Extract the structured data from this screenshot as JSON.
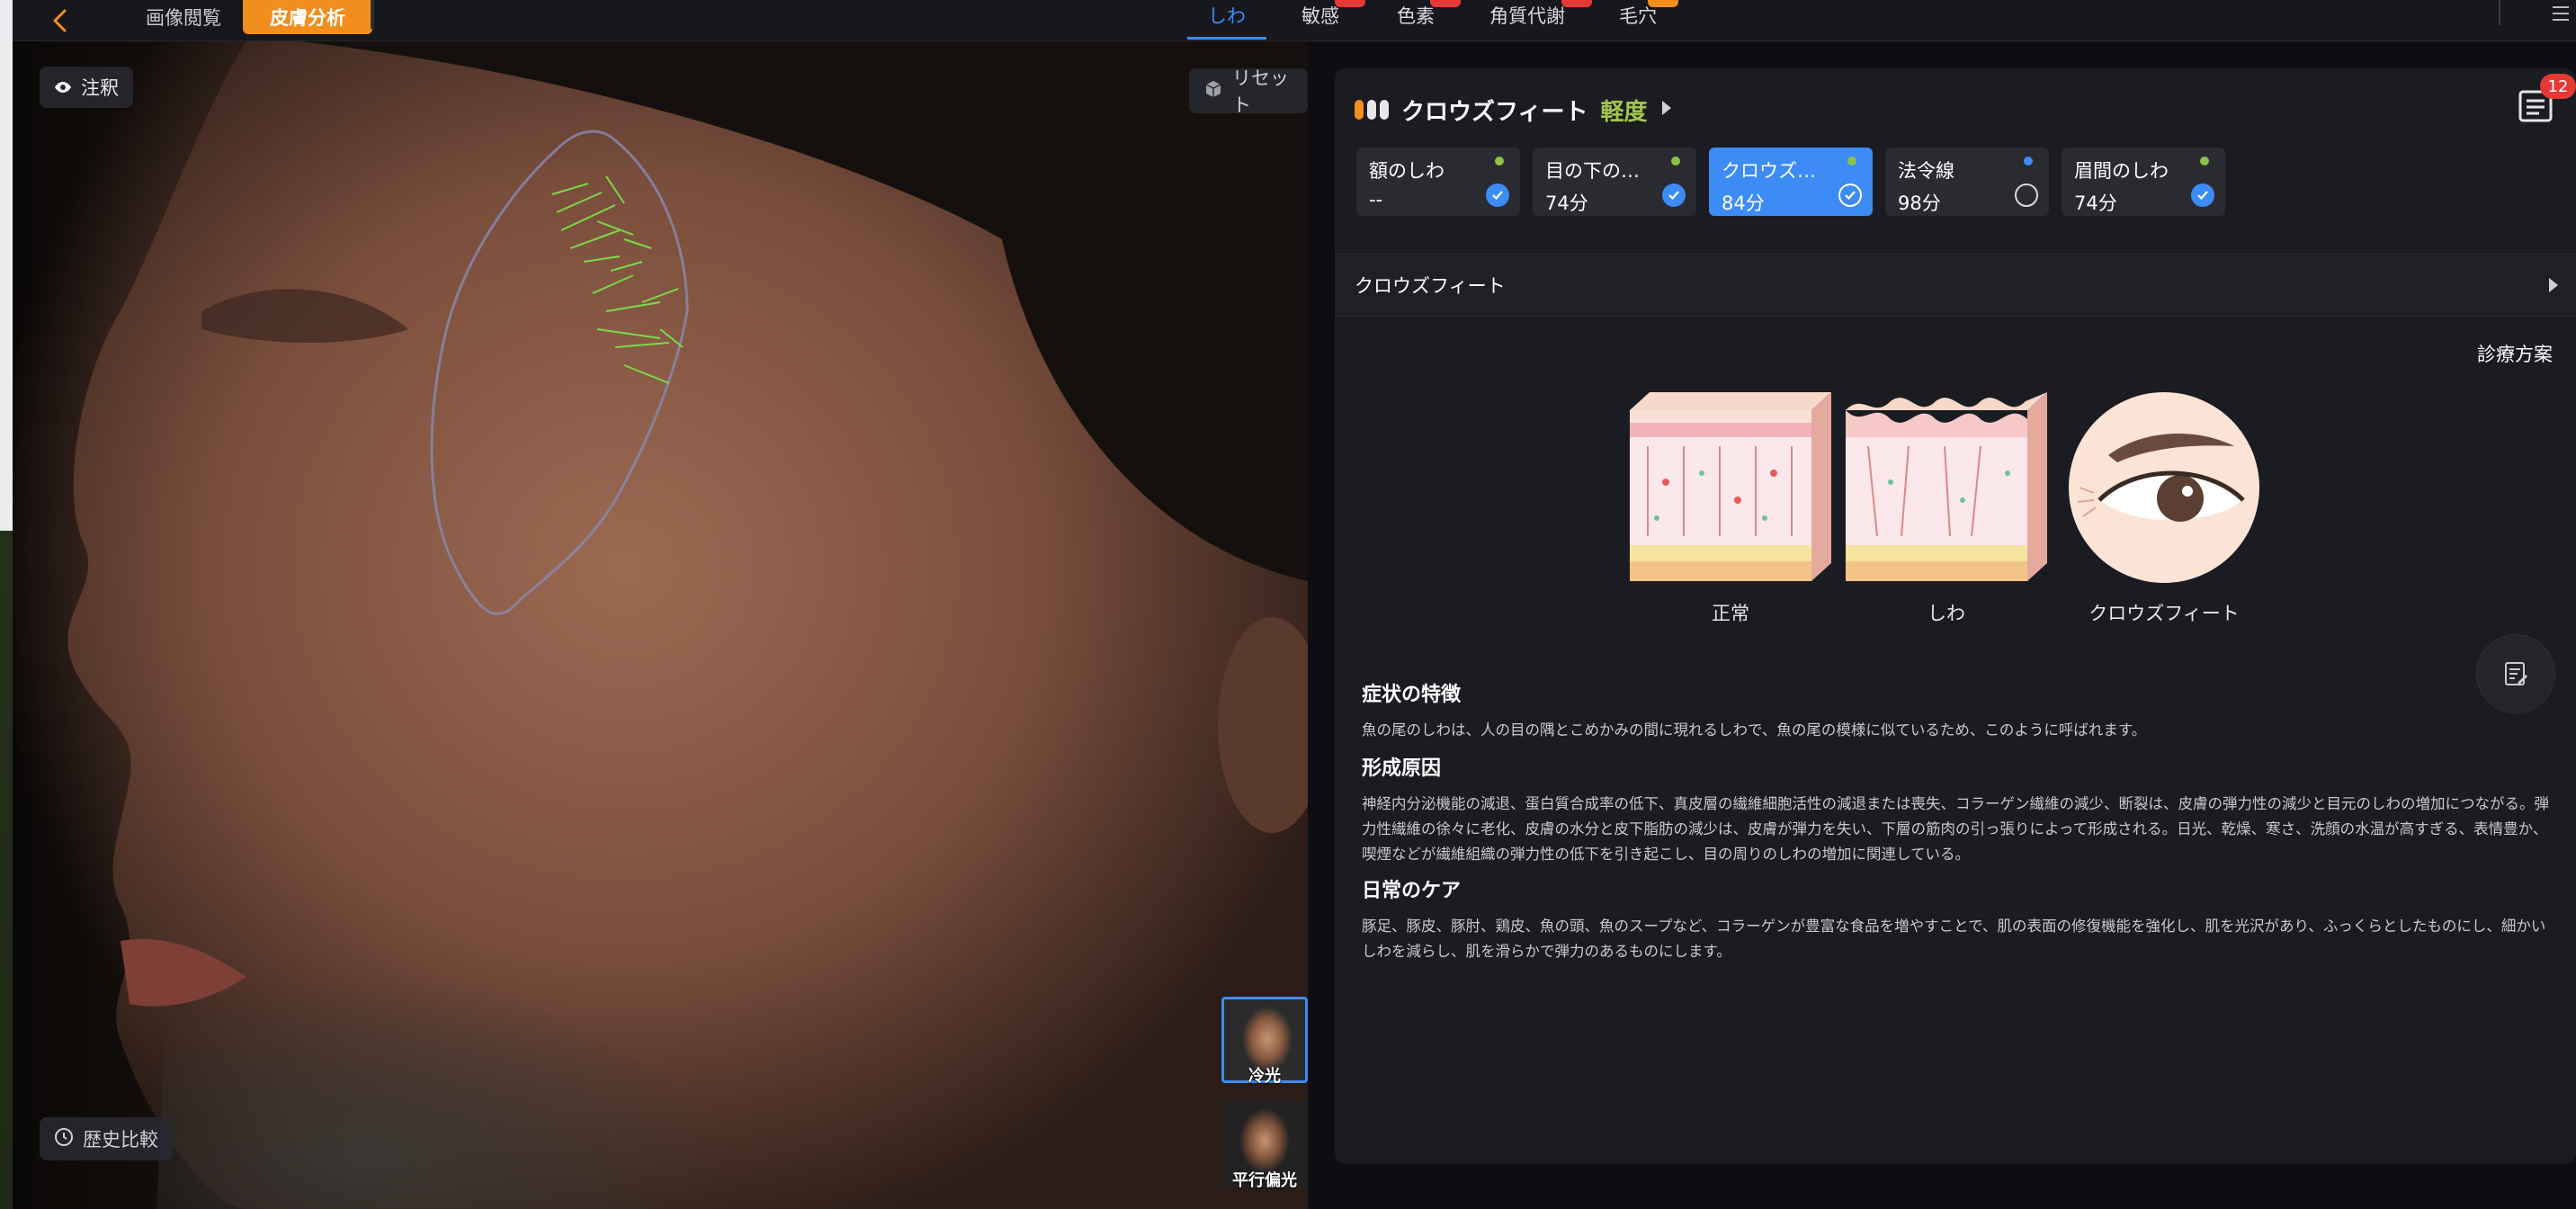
{
  "topbar": {
    "back_icon": "chevron-left-icon",
    "tab_image_view": "画像閲覧",
    "tab_skin_analysis": "皮膚分析",
    "categories": [
      {
        "label": "しわ",
        "active": true
      },
      {
        "label": "敏感",
        "badge_color": "#e53935"
      },
      {
        "label": "色素",
        "badge_color": "#e53935"
      },
      {
        "label": "角質代謝",
        "badge_color": "#e53935"
      },
      {
        "label": "毛穴",
        "badge_color": "#f28e1d"
      }
    ],
    "menu_icon": "menu-icon"
  },
  "viewer": {
    "note_label": "注釈",
    "reset_label": "リセット",
    "history_label": "歴史比較",
    "thumbnails": [
      {
        "label": "冷光",
        "selected": true
      },
      {
        "label": "平行偏光",
        "selected": false
      }
    ]
  },
  "panel": {
    "title": "クロウズフィート",
    "level": "軽度",
    "report_badge": "12",
    "cards": [
      {
        "name": "額のしわ",
        "score": "--",
        "dot_color": "#8bc34a",
        "checked": true,
        "active": false
      },
      {
        "name": "目の下の細…",
        "score": "74分",
        "dot_color": "#8bc34a",
        "checked": true,
        "active": false
      },
      {
        "name": "クロウズフ…",
        "score": "84分",
        "dot_color": "#8bc34a",
        "checked": true,
        "active": true
      },
      {
        "name": "法令線",
        "score": "98分",
        "dot_color": "#3d8bf5",
        "checked": false,
        "active": false
      },
      {
        "name": "眉間のしわ",
        "score": "74分",
        "dot_color": "#8bc34a",
        "checked": true,
        "active": false
      }
    ],
    "section_label": "クロウズフィート",
    "treatment_label": "診療方案",
    "illustrations": [
      "正常",
      "しわ",
      "クロウズフィート"
    ],
    "symptom_title": "症状の特徴",
    "symptom_text": "魚の尾のしわは、人の目の隅とこめかみの間に現れるしわで、魚の尾の模様に似ているため、このように呼ばれます。",
    "cause_title": "形成原因",
    "cause_text": "神経内分泌機能の減退、蛋白質合成率の低下、真皮層の繊維細胞活性の減退または喪失、コラーゲン繊維の減少、断裂は、皮膚の弾力性の減少と目元のしわの増加につながる。弾力性繊維の徐々に老化、皮膚の水分と皮下脂肪の減少は、皮膚が弾力を失い、下層の筋肉の引っ張りによって形成される。日光、乾燥、寒さ、洗顔の水温が高すぎる、表情豊か、喫煙などが繊維組織の弾力性の低下を引き起こし、目の周りのしわの増加に関連している。",
    "care_title": "日常のケア",
    "care_text": "豚足、豚皮、豚肘、鶏皮、魚の頭、魚のスープなど、コラーゲンが豊富な食品を増やすことで、肌の表面の修復機能を強化し、肌を光沢があり、ふっくらとしたものにし、細かいしわを減らし、肌を滑らかで弾力のあるものにします。"
  },
  "colors": {
    "accent": "#3d8bf5",
    "orange": "#f28e1d",
    "level_green": "#a0c74a",
    "panel_bg": "#1b1c22"
  }
}
